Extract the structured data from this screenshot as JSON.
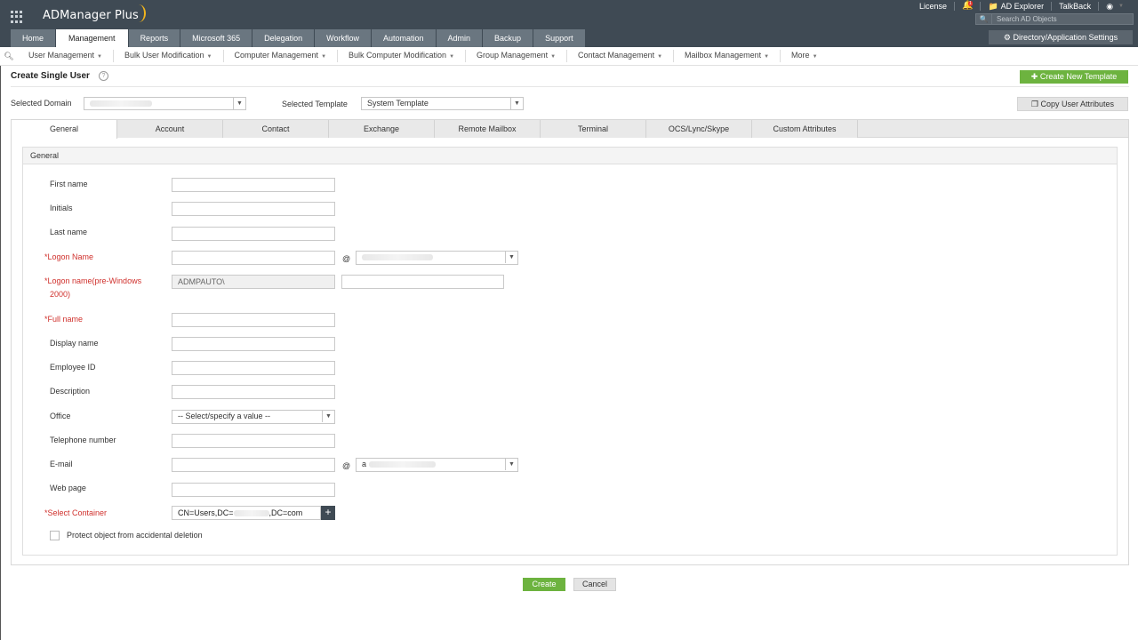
{
  "app": {
    "brand": "ADManager Plus",
    "top_links": {
      "license": "License",
      "notification_count": "1",
      "ad_explorer": "AD Explorer",
      "talkback": "TalkBack"
    },
    "search_placeholder": "Search AD Objects",
    "dir_settings": "Directory/Application Settings",
    "colors": {
      "header": "#3f4a54",
      "tab": "#6a7680",
      "accent_green": "#6db33f",
      "required_red": "#d0312d",
      "bell": "#f2b51c"
    }
  },
  "nav": {
    "tabs": [
      "Home",
      "Management",
      "Reports",
      "Microsoft 365",
      "Delegation",
      "Workflow",
      "Automation",
      "Admin",
      "Backup",
      "Support"
    ],
    "active": "Management"
  },
  "subnav": {
    "items": [
      "User Management",
      "Bulk User Modification",
      "Computer Management",
      "Bulk Computer Modification",
      "Group Management",
      "Contact Management",
      "Mailbox Management",
      "More"
    ]
  },
  "page": {
    "title": "Create Single User",
    "create_template": "Create New Template",
    "copy_attributes": "Copy User Attributes",
    "selected_domain_label": "Selected Domain",
    "selected_template_label": "Selected Template",
    "selected_template_value": "System Template"
  },
  "form_tabs": [
    "General",
    "Account",
    "Contact",
    "Exchange",
    "Remote Mailbox",
    "Terminal",
    "OCS/Lync/Skype",
    "Custom Attributes"
  ],
  "general": {
    "section_title": "General",
    "first_name": "First name",
    "initials": "Initials",
    "last_name": "Last name",
    "logon_name": "Logon Name",
    "logon_pre_line1": "Logon name(pre-Windows",
    "logon_pre_line2": "2000)",
    "logon_pre_prefix": "ADMPAUTO\\",
    "full_name": "Full name",
    "display_name": "Display name",
    "employee_id": "Employee ID",
    "description": "Description",
    "office": "Office",
    "office_value": "-- Select/specify a value --",
    "telephone": "Telephone number",
    "email": "E-mail",
    "email_domain_prefix": "a",
    "web_page": "Web page",
    "select_container": "Select Container",
    "container_prefix": "CN=Users,DC=",
    "container_suffix": ",DC=com",
    "at_symbol": "@",
    "required_mark": "*",
    "protect_label": "Protect object from accidental deletion"
  },
  "actions": {
    "create": "Create",
    "cancel": "Cancel"
  },
  "icons": [
    "apps-grid-icon",
    "bell-icon",
    "folder-icon",
    "user-circle-icon",
    "search-icon",
    "gear-icon",
    "help-icon",
    "plus-icon",
    "copy-icon",
    "chevron-down-icon"
  ]
}
